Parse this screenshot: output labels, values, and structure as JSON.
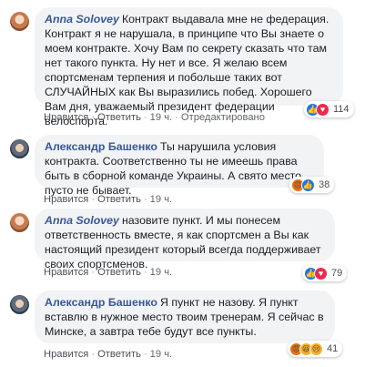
{
  "comments": [
    {
      "author": "Anna Solovey",
      "text": "Контракт выдавала мне не федерация. Контракт я не нарушала, в принципе что Вы знаете о моем контракте. Хочу Вам по секрету сказать что там нет такого пункта. Ну нет и все. Я желаю всем спортсменам терпения и побольше таких вот СЛУЧАЙНЫХ как Вы выразились побед. Хорошего Вам дня, уважаемый президент федерации велоспорта.",
      "like_label": "Нравится",
      "reply_label": "Ответить",
      "time": "19 ч.",
      "edited": "Отредактировано",
      "reaction_icons": [
        "like-icon",
        "love-icon"
      ],
      "reaction_count": "114"
    },
    {
      "author": "Александр Башенко",
      "text": "Ты нарушила условия контракта. Соответственно ты не имеешь права быть в сборной команде Украины. А свято место пусто не бывает.",
      "like_label": "Нравится",
      "reply_label": "Ответить",
      "time": "19 ч.",
      "reaction_icons": [
        "angry-icon",
        "like-icon"
      ],
      "reaction_count": "38"
    },
    {
      "author": "Anna Solovey",
      "text": "назовите пункт. И мы понесем ответственность вместе, я как спортсмен а Вы как настоящий президент который всегда поддерживает своих спортсменов.",
      "like_label": "Нравится",
      "reply_label": "Ответить",
      "time": "19 ч.",
      "reaction_icons": [
        "like-icon",
        "love-icon"
      ],
      "reaction_count": "79"
    },
    {
      "author": "Александр Башенко",
      "text": "Я пункт не назову. Я пункт вставлю в нужное место твоим тренерам. Я сейчас в Минске, а завтра тебе будут все пункты.",
      "like_label": "Нравится",
      "reply_label": "Ответить",
      "time": "19 ч.",
      "reaction_icons": [
        "angry-icon",
        "haha-icon",
        "sad-icon"
      ],
      "reaction_count": "41"
    }
  ],
  "colors": {
    "author": "#385898",
    "bubble": "#f2f3f5",
    "like": "#1877f2",
    "love": "#f0284a",
    "angry": "#e9710f"
  }
}
